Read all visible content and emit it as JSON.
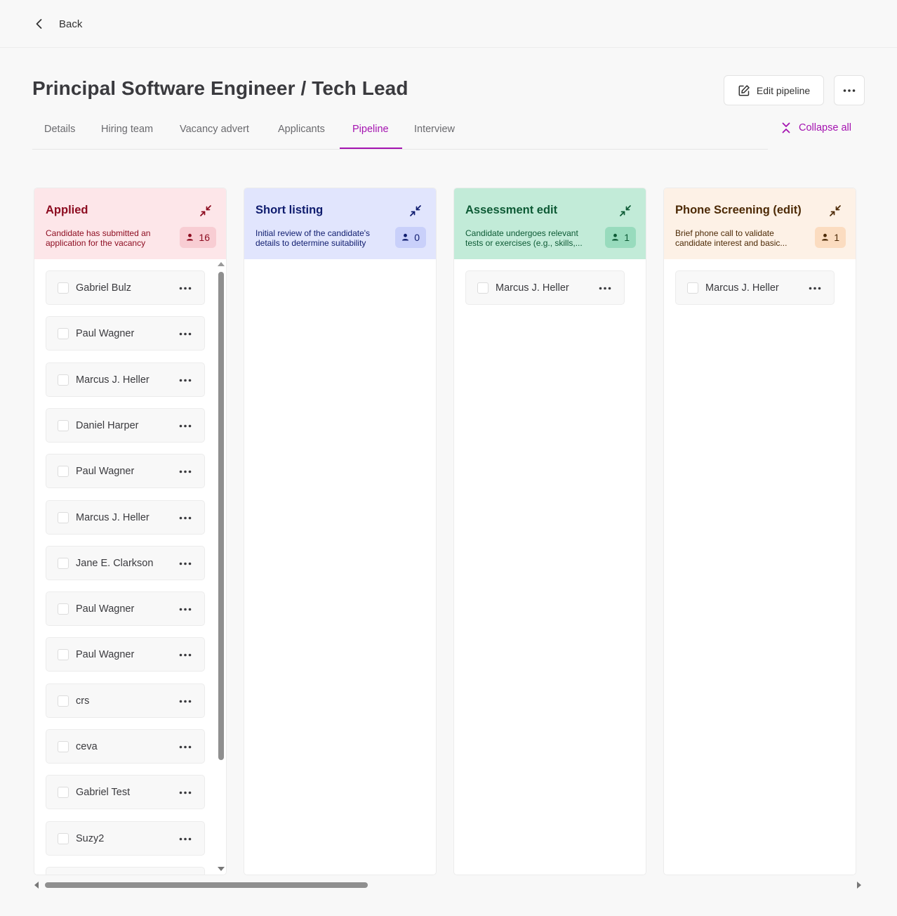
{
  "header": {
    "back_label": "Back"
  },
  "page": {
    "title": "Principal Software Engineer / Tech Lead",
    "edit_pipeline_label": "Edit pipeline",
    "collapse_all_label": "Collapse all"
  },
  "tabs": [
    {
      "label": "Details"
    },
    {
      "label": "Hiring team"
    },
    {
      "label": "Vacancy advert"
    },
    {
      "label": "Applicants"
    },
    {
      "label": "Pipeline",
      "active": true
    },
    {
      "label": "Interview"
    }
  ],
  "columns": [
    {
      "title": "Applied",
      "description": "Candidate has submitted an application for the vacancy",
      "count": "16",
      "colors": {
        "head_bg": "#fde6e9",
        "title": "#8c0b1f",
        "desc": "#8c0b1f",
        "badge_bg": "#f8cdd3",
        "icon": "#8c0b1f"
      },
      "candidates": [
        {
          "name": "Gabriel Bulz"
        },
        {
          "name": "Paul Wagner"
        },
        {
          "name": "Marcus J. Heller"
        },
        {
          "name": "Daniel Harper"
        },
        {
          "name": "Paul Wagner"
        },
        {
          "name": "Marcus J. Heller"
        },
        {
          "name": "Jane E. Clarkson"
        },
        {
          "name": "Paul Wagner"
        },
        {
          "name": "Paul Wagner"
        },
        {
          "name": "crs"
        },
        {
          "name": "ceva"
        },
        {
          "name": "Gabriel Test"
        },
        {
          "name": "Suzy2"
        }
      ]
    },
    {
      "title": "Short listing",
      "description": "Initial review of the candidate's details to determine suitability",
      "count": "0",
      "colors": {
        "head_bg": "#e1e5fd",
        "title": "#0f1c6e",
        "desc": "#0f1c6e",
        "badge_bg": "#c9d0fa",
        "icon": "#0f1c6e"
      },
      "candidates": []
    },
    {
      "title": "Assessment edit",
      "description": "Candidate undergoes relevant tests or exercises (e.g., skills,...",
      "count": "1",
      "colors": {
        "head_bg": "#c2ebd8",
        "title": "#0d5a35",
        "desc": "#0d5a35",
        "badge_bg": "#98dbbd",
        "icon": "#0d5a35"
      },
      "candidates": [
        {
          "name": "Marcus J. Heller"
        }
      ]
    },
    {
      "title": "Phone Screening (edit)",
      "description": "Brief phone call to validate candidate interest and basic...",
      "count": "1",
      "colors": {
        "head_bg": "#fdf1e6",
        "title": "#4d2a06",
        "desc": "#4d2a06",
        "badge_bg": "#fbdcc0",
        "icon": "#4d2a06"
      },
      "candidates": [
        {
          "name": "Marcus J. Heller"
        }
      ]
    }
  ]
}
